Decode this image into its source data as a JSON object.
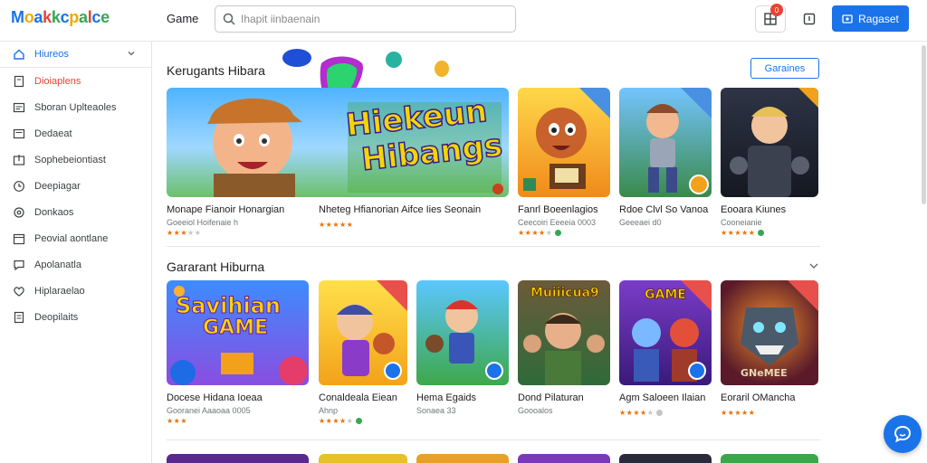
{
  "header": {
    "logo": [
      "M",
      "o",
      "a",
      "k",
      "k",
      "c",
      "p",
      "a",
      "l",
      "c",
      "e"
    ],
    "nav_label": "Game",
    "search_placeholder": "Ihapit iinbaenain",
    "notif_count": "0",
    "primary_button": "Ragaset"
  },
  "sidebar": {
    "items": [
      {
        "label": "Hiureos",
        "icon": "home-icon"
      },
      {
        "label": "Dioiaplens",
        "icon": "file-icon"
      },
      {
        "label": "Sboran Uplteaoles",
        "icon": "image-icon"
      },
      {
        "label": "Dedaeat",
        "icon": "list-icon"
      },
      {
        "label": "Sophebeiontiast",
        "icon": "upload-icon"
      },
      {
        "label": "Deepiagar",
        "icon": "clock-icon"
      },
      {
        "label": "Donkaos",
        "icon": "settings-icon"
      },
      {
        "label": "Peovial aontlane",
        "icon": "calendar-icon"
      },
      {
        "label": "Apolanatla",
        "icon": "chat-icon"
      },
      {
        "label": "Hiplaraelao",
        "icon": "heart-icon"
      },
      {
        "label": "Deopilaits",
        "icon": "document-icon"
      }
    ]
  },
  "sections": [
    {
      "title": "Kerugants Hibara",
      "action": "Garaines",
      "hero_art_text": [
        "Hiekeun",
        "Hibangs"
      ],
      "cards": [
        {
          "title": "Monape Fianoir Honargian",
          "sub": "Goeeiol Hoifenaie h",
          "stars": 3
        },
        {
          "title": "Nheteg Hfianorian Aifce Iies Seonain",
          "sub": "",
          "stars": 5
        },
        {
          "title": "Fanrl Boeenlagios",
          "sub": "Ceecoiri Eeeeia 0003",
          "stars": 4
        },
        {
          "title": "Rdoe Clvl So Vanoa",
          "sub": "Geeeaei d0",
          "stars": 0
        },
        {
          "title": "Eooara Kiunes",
          "sub": "Cooneianie",
          "stars": 5
        }
      ]
    },
    {
      "title": "Gararant Hiburna",
      "cards": [
        {
          "title": "Docese Hidana Ioeaa",
          "sub": "Gooranei Aaaoaa 0005",
          "stars": 3,
          "art": [
            "Savihian",
            "GAME"
          ]
        },
        {
          "title": "Conaldeala Eiean",
          "sub": "Ahnp",
          "stars": 4
        },
        {
          "title": "Hema Egaids",
          "sub": "Sonaea 33",
          "stars": 0
        },
        {
          "title": "Dond Pilaturan",
          "sub": "Goooalos",
          "stars": 0,
          "art": [
            "Muiiicua9"
          ]
        },
        {
          "title": "Agm Saloeen Ilaian",
          "sub": "",
          "stars": 4,
          "art": [
            "GAME"
          ]
        },
        {
          "title": "Eoraril OMancha",
          "sub": "",
          "stars": 5,
          "art": [
            "GNeMEE"
          ]
        }
      ]
    }
  ],
  "colors": {
    "accent": "#1a73e8",
    "active": "#ea4335",
    "star": "#e8710a"
  }
}
